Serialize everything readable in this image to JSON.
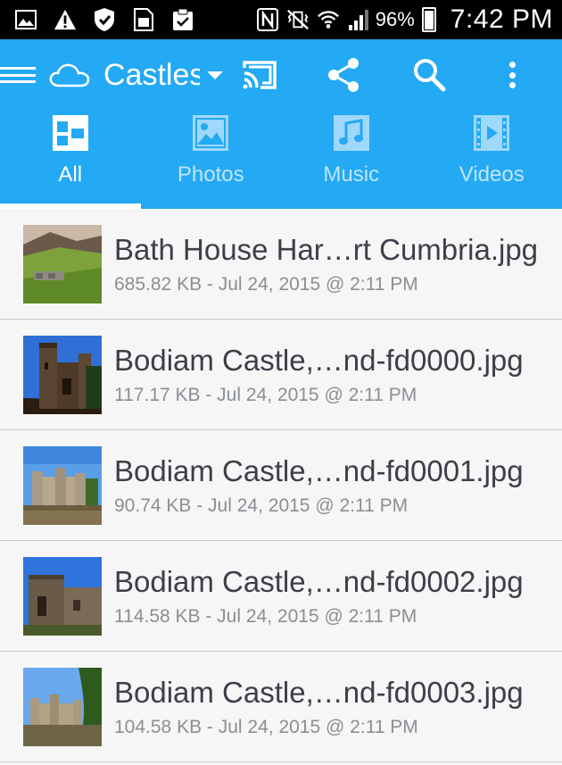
{
  "status_bar": {
    "left_icons": [
      "gallery-icon",
      "warning-icon",
      "shield-icon",
      "sim-card-icon",
      "clipboard-check-icon"
    ],
    "right_icons": [
      "nfc-icon",
      "vibrate-mute-icon",
      "wifi-icon",
      "signal-icon"
    ],
    "battery_percent": "96%",
    "battery_level": 0.96,
    "time": "7:42 PM"
  },
  "toolbar": {
    "title": "Castles",
    "icons": [
      "menu-icon",
      "cloud-icon",
      "dropdown-caret-icon",
      "cast-icon",
      "share-icon",
      "search-icon",
      "more-vert-icon"
    ]
  },
  "tabs": [
    {
      "label": "All",
      "icon": "all-grid-icon",
      "active": true
    },
    {
      "label": "Photos",
      "icon": "photo-icon",
      "active": false
    },
    {
      "label": "Music",
      "icon": "music-icon",
      "active": false
    },
    {
      "label": "Videos",
      "icon": "video-icon",
      "active": false
    }
  ],
  "colors": {
    "accent": "#24a9f4",
    "inactive_tab_text": "#bde6fd",
    "filename_text": "#3c3f48",
    "meta_text": "#8a8f94"
  },
  "files": [
    {
      "name": "Bath House Har…rt Cumbria.jpg",
      "meta": "685.82 KB - Jul 24, 2015 @ 2:11 PM"
    },
    {
      "name": "Bodiam Castle,…nd-fd0000.jpg",
      "meta": "117.17 KB - Jul 24, 2015 @ 2:11 PM"
    },
    {
      "name": "Bodiam Castle,…nd-fd0001.jpg",
      "meta": "90.74 KB - Jul 24, 2015 @ 2:11 PM"
    },
    {
      "name": "Bodiam Castle,…nd-fd0002.jpg",
      "meta": "114.58 KB - Jul 24, 2015 @ 2:11 PM"
    },
    {
      "name": "Bodiam Castle,…nd-fd0003.jpg",
      "meta": "104.58 KB - Jul 24, 2015 @ 2:11 PM"
    }
  ]
}
